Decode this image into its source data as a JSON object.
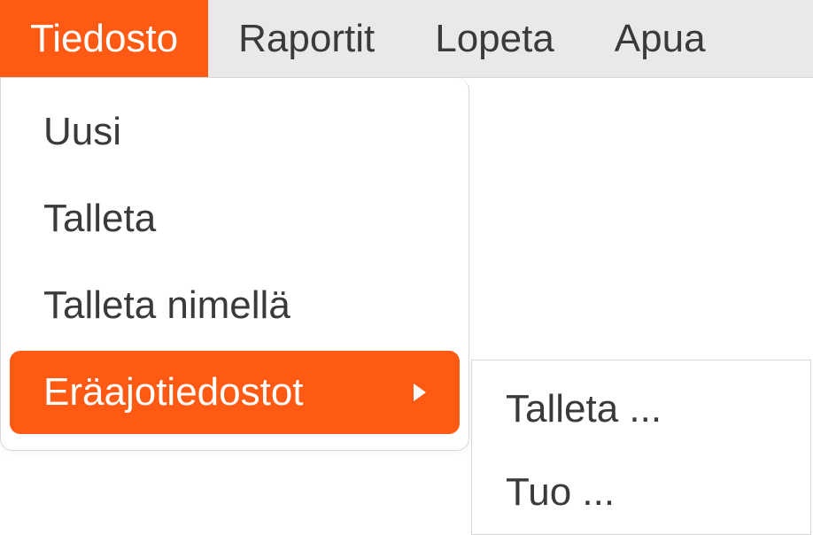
{
  "menubar": {
    "items": [
      {
        "label": "Tiedosto",
        "active": true
      },
      {
        "label": "Raportit",
        "active": false
      },
      {
        "label": "Lopeta",
        "active": false
      },
      {
        "label": "Apua",
        "active": false
      }
    ]
  },
  "dropdown": {
    "items": [
      {
        "label": "Uusi",
        "active": false,
        "hasSubmenu": false
      },
      {
        "label": "Talleta",
        "active": false,
        "hasSubmenu": false
      },
      {
        "label": "Talleta nimellä",
        "active": false,
        "hasSubmenu": false
      },
      {
        "label": "Eräajotiedostot",
        "active": true,
        "hasSubmenu": true
      }
    ]
  },
  "submenu": {
    "items": [
      {
        "label": "Talleta ..."
      },
      {
        "label": "Tuo ..."
      }
    ]
  }
}
